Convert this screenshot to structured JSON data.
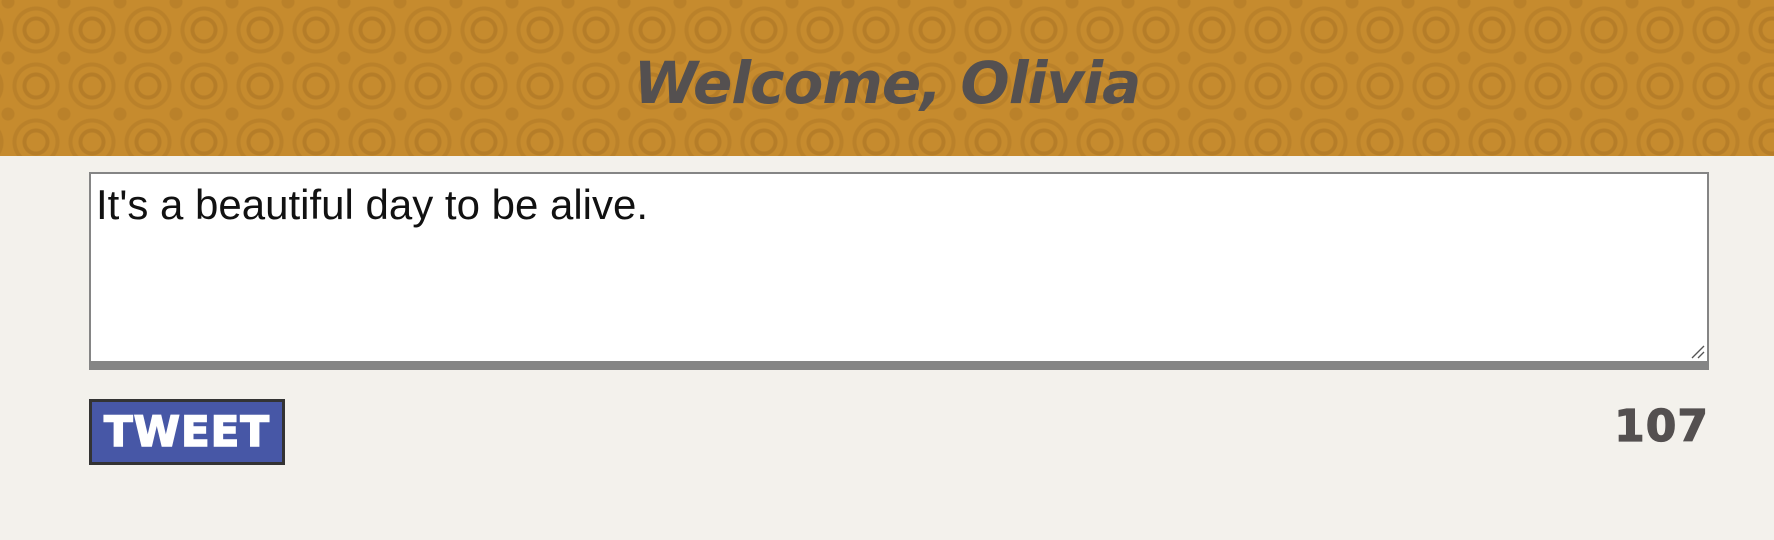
{
  "header": {
    "title": "Welcome, Olivia"
  },
  "composer": {
    "value": "It's a beautiful day to be alive."
  },
  "actions": {
    "tweet_label": "TWEET"
  },
  "counter": {
    "remaining": "107"
  },
  "colors": {
    "header_background": "#c68b2e",
    "title_text": "#545050",
    "button_background": "#4757a6",
    "page_background": "#f3f1ec"
  },
  "icons": {
    "resize": "resize-grip-icon"
  }
}
